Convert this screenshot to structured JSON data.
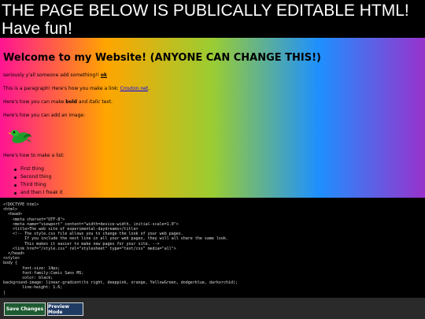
{
  "banner": {
    "line1": "THE PAGE BELOW IS PUBLICALLY EDITABLE HTML!",
    "line2": "Have fun!"
  },
  "preview": {
    "heading": "Welcome to my Website! (ANYONE CAN CHANGE THIS!)",
    "p1_text": "seriously y'all someone add something!! ",
    "p1_ok": "ok",
    "p2_text": "This is a paragraph! Here's how you make a link: ",
    "p2_link": "Crouton.net",
    "p2_end": ".",
    "p3_a": "Here's how you can make ",
    "p3_bold": "bold",
    "p3_b": " and ",
    "p3_italic": "italic",
    "p3_c": " text.",
    "p4": "Here's how you can add an image:",
    "p5": "Here's how to make a list:",
    "list": [
      "First thing",
      "Second thing",
      "Third thing",
      "and then I freak it"
    ]
  },
  "editor": {
    "lines": [
      "<!DOCTYPE html>",
      "<html>",
      "  <head>",
      "    <meta charset=\"UTF-8\">",
      "    <meta name=\"viewport\" content=\"width=device-width, initial-scale=1.0\">",
      "    <title>The web site of experimental-daydreams</title>",
      "    <!-- The style.css file allows you to change the look of your web pages.",
      "         If you include the next line in all your web pages, they will all share the same look.",
      "         This makes it easier to make new pages for your site. -->",
      "    <link href=\"/style.css\" rel=\"stylesheet\" type=\"text/css\" media=\"all\">",
      "  </head>",
      "<style>",
      "body {",
      "        font-size: 14px;",
      "        font-family:Comic Sans MS;",
      "        color: black;",
      "background-image: linear-gradient(to right, deeppink, orange, YellowGreen, dodgerblue, darkorchid);",
      "        line-height: 1.6;",
      "|"
    ]
  },
  "buttons": {
    "save": "Save Changes",
    "preview": "Preview Mode"
  },
  "colors": {
    "save_bg": "#1e5b32",
    "preview_bg": "#1f3a63",
    "bird": "bird-icon-green"
  }
}
